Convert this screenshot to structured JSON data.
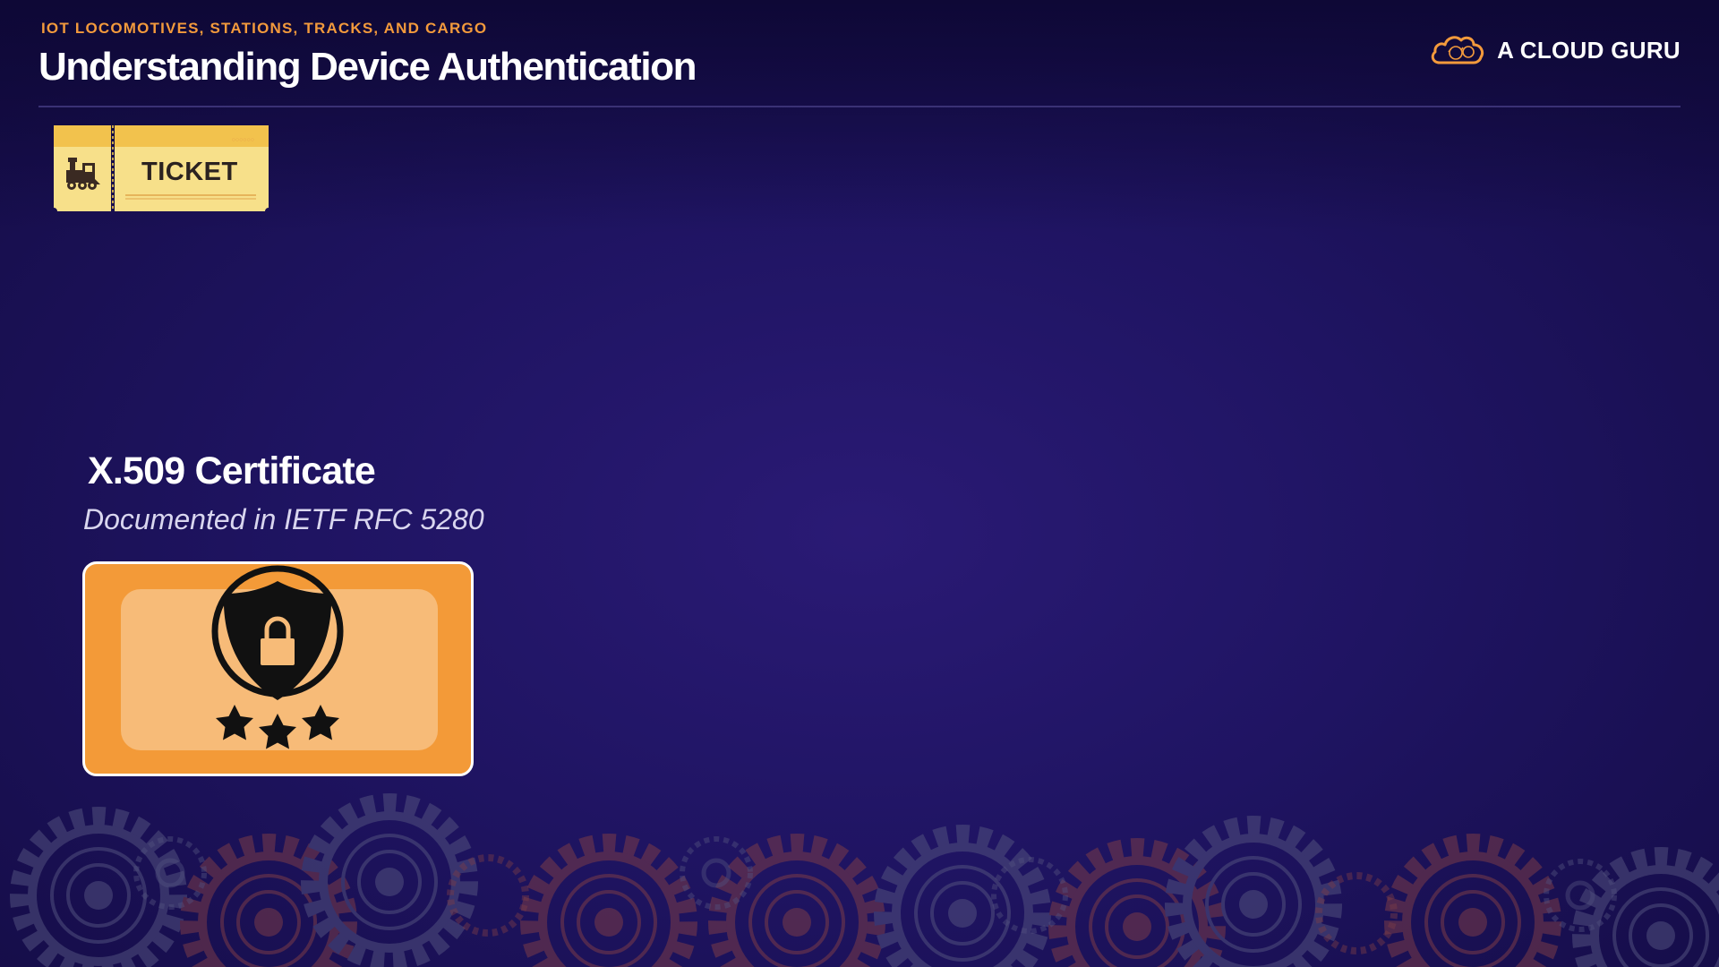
{
  "header": {
    "course_label": "IOT LOCOMOTIVES, STATIONS, TRACKS, AND CARGO",
    "title": "Understanding Device Authentication"
  },
  "brand": {
    "name": "A CLOUD GURU",
    "icon": "cloud-logo-icon"
  },
  "ticket": {
    "label": "TICKET",
    "icon": "locomotive-icon"
  },
  "certificate": {
    "title": "X.509 Certificate",
    "subtitle": "Documented in IETF RFC 5280",
    "icon": "shield-lock-stars-icon",
    "star_count": 3
  },
  "colors": {
    "background": "#1f1462",
    "accent_orange": "#f39a3c",
    "ticket_yellow": "#f7e08a",
    "card_orange": "#f39a38",
    "card_inner": "#f7bb78"
  }
}
